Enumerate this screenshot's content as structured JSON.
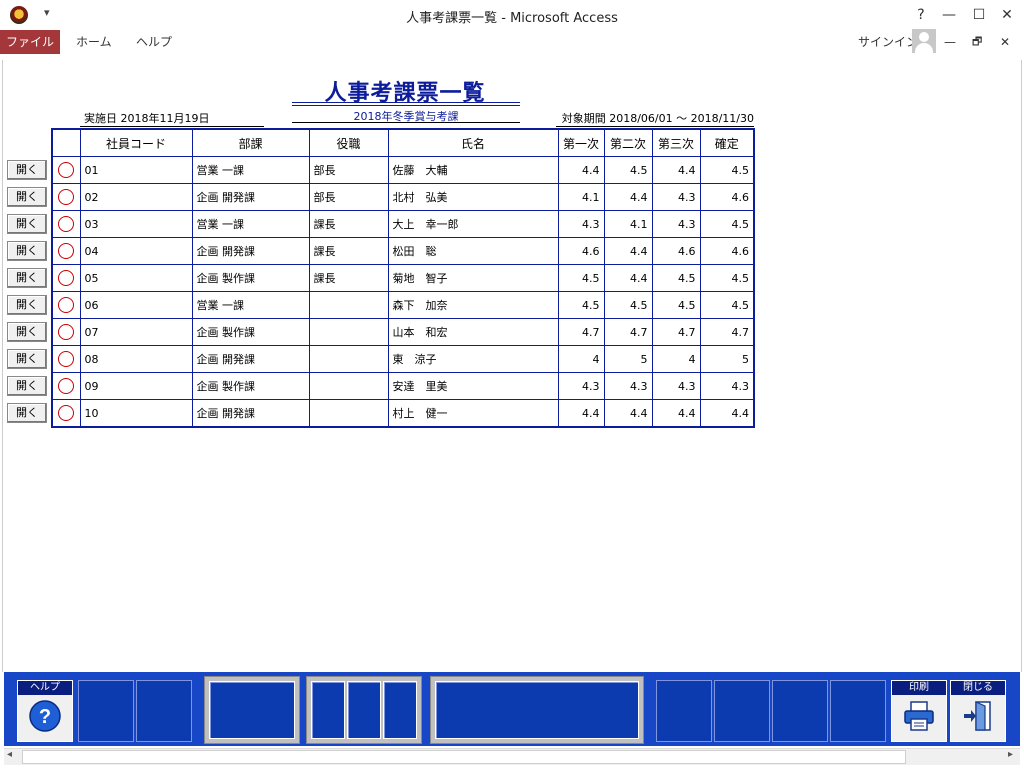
{
  "window": {
    "title": "人事考課票一覧 - Microsoft Access",
    "qa_arrow": "▾",
    "help": "?",
    "minimize": "—",
    "maximize": "☐",
    "close": "✕"
  },
  "ribbon": {
    "tabs": [
      "ファイル",
      "ホーム",
      "ヘルプ"
    ],
    "signin": "サインイン",
    "ribbon_min": "—",
    "restore": "🗗",
    "close": "✕"
  },
  "form": {
    "title": "人事考課票一覧",
    "subtitle": "2018年冬季賞与考課",
    "impl_date": "実施日 2018年11月19日",
    "period": "対象期間 2018/06/01 ～ 2018/11/30",
    "open_label": "開く",
    "columns": [
      "",
      "社員コード",
      "部課",
      "役職",
      "氏名",
      "第一次",
      "第二次",
      "第三次",
      "確定"
    ],
    "rows": [
      {
        "code": "01",
        "dept": "営業 一課",
        "pos": "部長",
        "name": "佐藤　大輔",
        "s1": "4.4",
        "s2": "4.5",
        "s3": "4.4",
        "fin": "4.5"
      },
      {
        "code": "02",
        "dept": "企画 開発課",
        "pos": "部長",
        "name": "北村　弘美",
        "s1": "4.1",
        "s2": "4.4",
        "s3": "4.3",
        "fin": "4.6"
      },
      {
        "code": "03",
        "dept": "営業 一課",
        "pos": "課長",
        "name": "大上　幸一郎",
        "s1": "4.3",
        "s2": "4.1",
        "s3": "4.3",
        "fin": "4.5"
      },
      {
        "code": "04",
        "dept": "企画 開発課",
        "pos": "課長",
        "name": "松田　聡",
        "s1": "4.6",
        "s2": "4.4",
        "s3": "4.6",
        "fin": "4.6"
      },
      {
        "code": "05",
        "dept": "企画 製作課",
        "pos": "課長",
        "name": "菊地　智子",
        "s1": "4.5",
        "s2": "4.4",
        "s3": "4.5",
        "fin": "4.5"
      },
      {
        "code": "06",
        "dept": "営業 一課",
        "pos": "",
        "name": "森下　加奈",
        "s1": "4.5",
        "s2": "4.5",
        "s3": "4.5",
        "fin": "4.5"
      },
      {
        "code": "07",
        "dept": "企画 製作課",
        "pos": "",
        "name": "山本　和宏",
        "s1": "4.7",
        "s2": "4.7",
        "s3": "4.7",
        "fin": "4.7"
      },
      {
        "code": "08",
        "dept": "企画 開発課",
        "pos": "",
        "name": "東　涼子",
        "s1": "4",
        "s2": "5",
        "s3": "4",
        "fin": "5"
      },
      {
        "code": "09",
        "dept": "企画 製作課",
        "pos": "",
        "name": "安達　里美",
        "s1": "4.3",
        "s2": "4.3",
        "s3": "4.3",
        "fin": "4.3"
      },
      {
        "code": "10",
        "dept": "企画 開発課",
        "pos": "",
        "name": "村上　健一",
        "s1": "4.4",
        "s2": "4.4",
        "s3": "4.4",
        "fin": "4.4"
      }
    ]
  },
  "bottom": {
    "help_caption": "ヘルプ",
    "print_caption": "印刷",
    "close_caption": "閉じる"
  },
  "icons": {
    "help": "question-icon",
    "print": "printer-icon",
    "close": "exit-door-icon",
    "mark": "red-circle-icon"
  }
}
